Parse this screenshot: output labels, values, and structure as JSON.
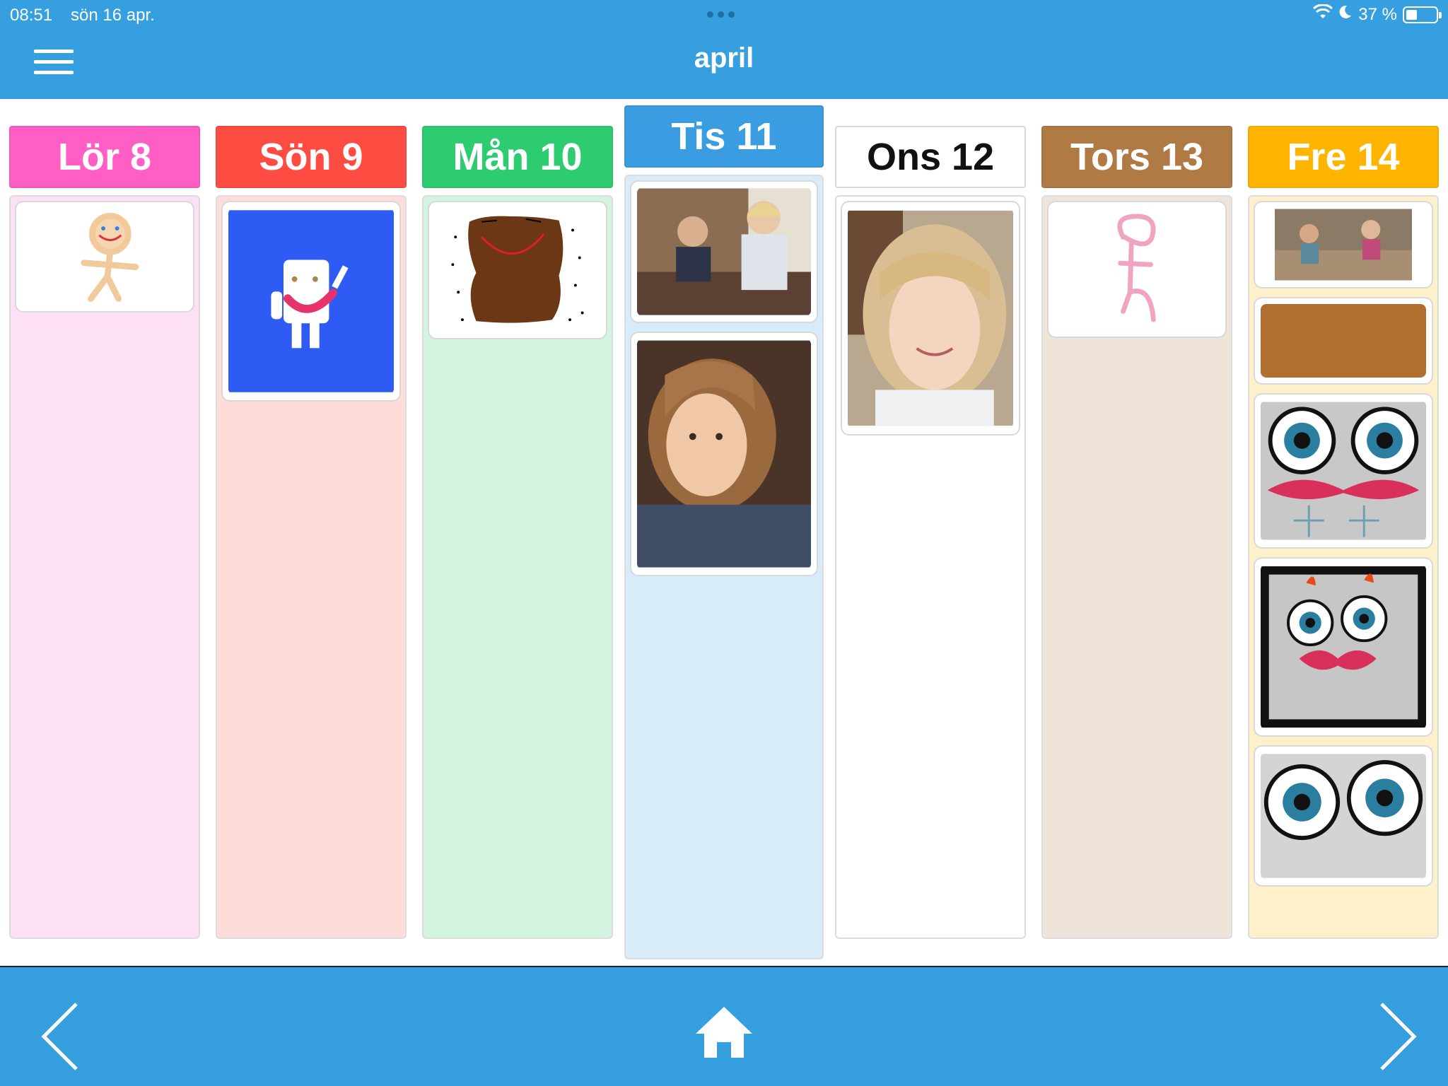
{
  "status_bar": {
    "time": "08:51",
    "date": "sön 16 apr.",
    "battery_text": "37 %",
    "battery_level": 0.37
  },
  "header": {
    "title": "april",
    "menu_icon": "hamburger-menu-icon"
  },
  "days": [
    {
      "label": "Lör 8",
      "color": "#ff5ec4",
      "bg": "#fde0f3",
      "text_color": "#ffffff"
    },
    {
      "label": "Sön 9",
      "color": "#ff4c43",
      "bg": "#fddcd9",
      "text_color": "#ffffff"
    },
    {
      "label": "Mån 10",
      "color": "#2ecc71",
      "bg": "#d2f4e1",
      "text_color": "#ffffff"
    },
    {
      "label": "Tis 11",
      "color": "#3a9de2",
      "bg": "#d7ebf9",
      "text_color": "#ffffff",
      "selected": true
    },
    {
      "label": "Ons 12",
      "color": "#ffffff",
      "bg": "#ffffff",
      "text_color": "#111111"
    },
    {
      "label": "Tors 13",
      "color": "#b07a45",
      "bg": "#efe4da",
      "text_color": "#ffffff"
    },
    {
      "label": "Fre 14",
      "color": "#ffb400",
      "bg": "#fff0cc",
      "text_color": "#ffffff"
    }
  ],
  "footer": {
    "prev_icon": "chevron-left-icon",
    "home_icon": "home-icon",
    "next_icon": "chevron-right-icon"
  },
  "colors": {
    "accent": "#369fdf"
  }
}
